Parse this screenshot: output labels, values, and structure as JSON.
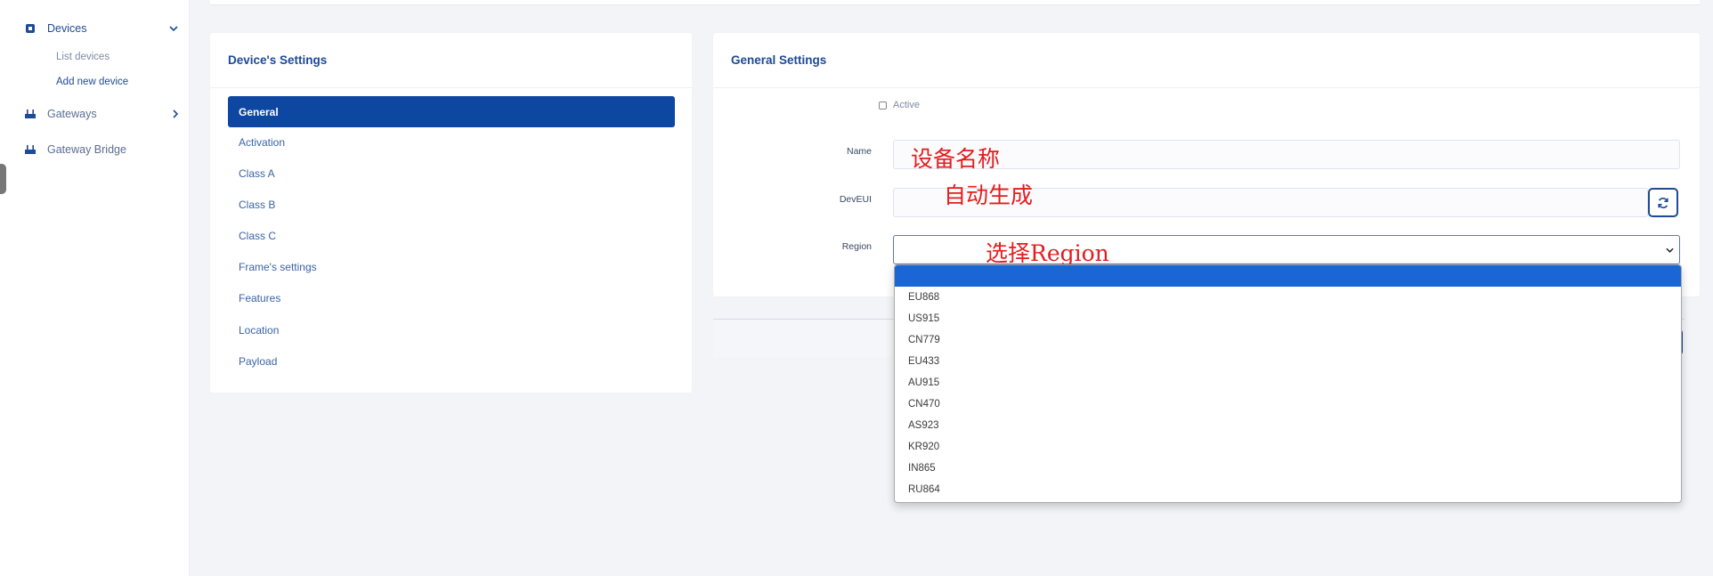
{
  "sidebar": {
    "devices": {
      "label": "Devices",
      "sub_items": [
        {
          "label": "List devices"
        },
        {
          "label": "Add new device"
        }
      ]
    },
    "gateways": {
      "label": "Gateways"
    },
    "gateway_bridge": {
      "label": "Gateway Bridge"
    }
  },
  "device_settings": {
    "title": "Device's Settings",
    "items": [
      {
        "label": "General",
        "selected": true
      },
      {
        "label": "Activation"
      },
      {
        "label": "Class A"
      },
      {
        "label": "Class B"
      },
      {
        "label": "Class C"
      },
      {
        "label": "Frame's settings"
      },
      {
        "label": "Features"
      },
      {
        "label": "Location"
      },
      {
        "label": "Payload"
      }
    ]
  },
  "general_settings": {
    "title": "General Settings",
    "active_label": "Active",
    "active_checked": false,
    "name_label": "Name",
    "name_value": "",
    "deveui_label": "DevEUI",
    "deveui_value": "",
    "region_label": "Region",
    "region_value": ""
  },
  "annotations": {
    "name_note": "设备名称",
    "deveui_note": "自动生成",
    "region_note": "选择Region"
  },
  "region_dropdown": {
    "options": [
      "EU868",
      "US915",
      "CN779",
      "EU433",
      "AU915",
      "CN470",
      "AS923",
      "KR920",
      "IN865",
      "RU864"
    ]
  },
  "colors": {
    "primary": "#0e47a1",
    "annotation": "#e31d1d",
    "dropdown_highlight": "#1a66d4"
  }
}
